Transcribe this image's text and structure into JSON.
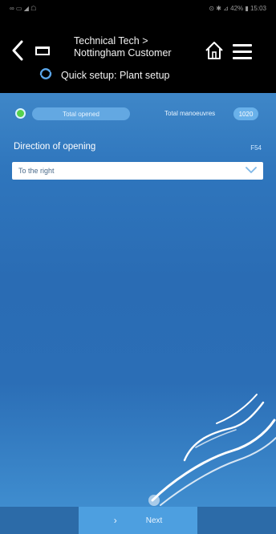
{
  "statusbar": {
    "left": "∞ ▭ ◢ ☖",
    "right": "⊙ ✱ ⊿ 42% ▮ 15:03"
  },
  "header": {
    "breadcrumb_line1": "Technical Tech >",
    "breadcrumb_line2": "Nottingham Customer",
    "subtitle": "Quick setup: Plant setup"
  },
  "status": {
    "pill_label": "Total opened",
    "maneuvers_label": "Total manoeuvres",
    "maneuvers_count": "1020"
  },
  "direction": {
    "label": "Direction of opening",
    "hint": "F54",
    "selected": "To the right"
  },
  "footer": {
    "next_label": "Next"
  },
  "colors": {
    "accent": "#4d9fe0",
    "status_on": "#56d14c"
  }
}
